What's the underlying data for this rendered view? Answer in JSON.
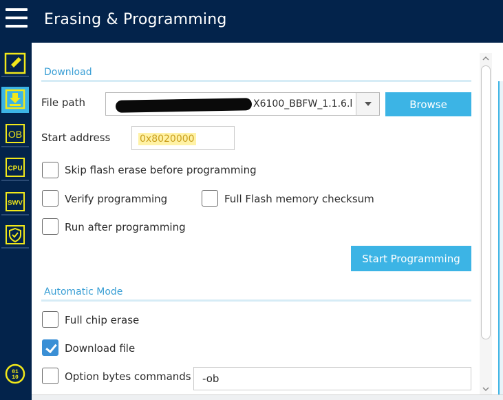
{
  "header": {
    "title": "Erasing & Programming"
  },
  "sidebar": {
    "items": [
      {
        "icon": "pencil-icon",
        "label": ""
      },
      {
        "icon": "download-icon",
        "label": ""
      },
      {
        "icon": "ob-icon",
        "label": "OB"
      },
      {
        "icon": "cpu-icon",
        "label": "CPU"
      },
      {
        "icon": "swv-icon",
        "label": "SWV"
      },
      {
        "icon": "shield-icon",
        "label": ""
      },
      {
        "icon": "binary-icon",
        "label": "01\n10"
      }
    ]
  },
  "download": {
    "section_title": "Download",
    "file_path_label": "File path",
    "file_path_value": "X6100_BBFW_1.1.6.l",
    "browse_label": "Browse",
    "start_address_label": "Start address",
    "start_address_value": "0x8020000",
    "skip_flash_erase_label": "Skip flash erase before programming",
    "skip_flash_erase_checked": false,
    "verify_label": "Verify programming",
    "verify_checked": false,
    "full_checksum_label": "Full Flash memory checksum",
    "full_checksum_checked": false,
    "run_after_label": "Run after programming",
    "run_after_checked": false,
    "start_programming_label": "Start Programming"
  },
  "automatic": {
    "section_title": "Automatic Mode",
    "full_chip_erase_label": "Full chip erase",
    "full_chip_erase_checked": false,
    "download_file_label": "Download file",
    "download_file_checked": true,
    "option_bytes_label": "Option bytes commands",
    "option_bytes_checked": false,
    "option_bytes_value": "-ob"
  },
  "colors": {
    "navy": "#03234b",
    "accent": "#3cb4e5",
    "section_title": "#3a9fd5",
    "checkbox_checked": "#3a8fd5",
    "address_highlight": "#fff2a6"
  }
}
